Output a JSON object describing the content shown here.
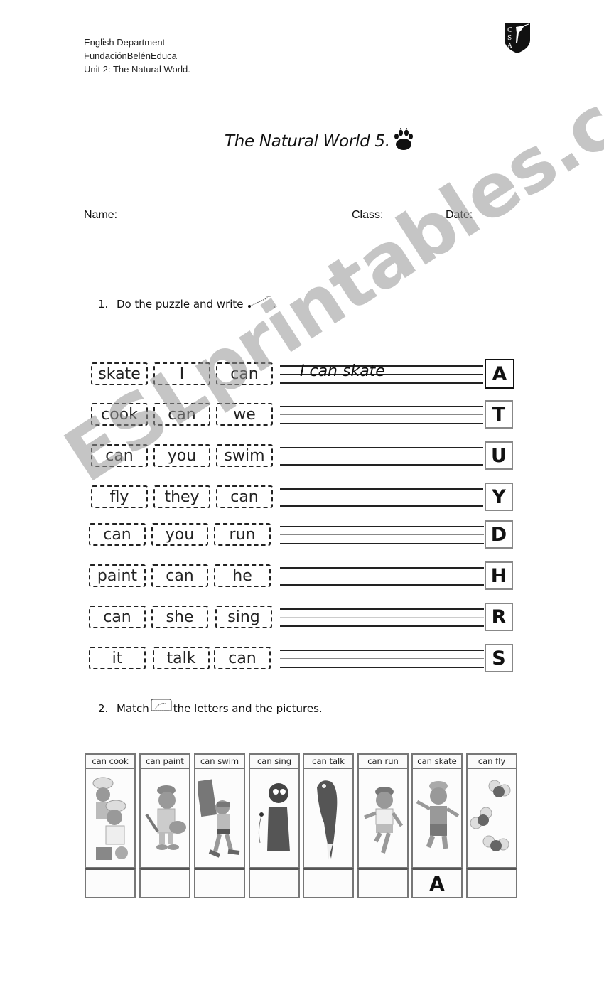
{
  "header": {
    "department": "English Department",
    "foundation": "FundaciónBelénEduca",
    "unit": "Unit 2: The Natural World."
  },
  "logo": {
    "icon": "school-crest-icon",
    "letters": "CSA"
  },
  "title": "The Natural World 5.",
  "title_icon": "paw-print-icon",
  "fields": {
    "name_label": "Name:",
    "class_label": "Class:",
    "date_label": "Date:"
  },
  "exercise1": {
    "number": "1.",
    "instruction": "Do the puzzle and write",
    "instruction_end": ".",
    "icon": "pencil-icon",
    "rows": [
      {
        "words": [
          "skate",
          "I",
          "can"
        ],
        "answer": "I can skate",
        "letter": "A"
      },
      {
        "words": [
          "cook",
          "can",
          "we"
        ],
        "answer": "",
        "letter": "T"
      },
      {
        "words": [
          "can",
          "you",
          "swim"
        ],
        "answer": "",
        "letter": "U"
      },
      {
        "words": [
          "fly",
          "they",
          "can"
        ],
        "answer": "",
        "letter": "Y"
      },
      {
        "words": [
          "can",
          "you",
          "run"
        ],
        "answer": "",
        "letter": "D"
      },
      {
        "words": [
          "paint",
          "can",
          "he"
        ],
        "answer": "",
        "letter": "H"
      },
      {
        "words": [
          "can",
          "she",
          "sing"
        ],
        "answer": "",
        "letter": "R"
      },
      {
        "words": [
          "it",
          "talk",
          "can"
        ],
        "answer": "",
        "letter": "S"
      }
    ]
  },
  "exercise2": {
    "number": "2.",
    "instruction_start": "Match",
    "instruction_end": "the letters and the pictures.",
    "icon": "drawing-icon",
    "columns": [
      {
        "label": "can cook",
        "picture": "chefs-cooking-picture",
        "answer": ""
      },
      {
        "label": "can paint",
        "picture": "painter-boy-picture",
        "answer": ""
      },
      {
        "label": "can swim",
        "picture": "swimmer-picture",
        "answer": ""
      },
      {
        "label": "can sing",
        "picture": "singer-picture",
        "answer": ""
      },
      {
        "label": "can talk",
        "picture": "parrot-picture",
        "answer": ""
      },
      {
        "label": "can run",
        "picture": "runner-boy-picture",
        "answer": ""
      },
      {
        "label": "can skate",
        "picture": "skater-boy-picture",
        "answer": "A"
      },
      {
        "label": "can fly",
        "picture": "birds-flying-picture",
        "answer": ""
      }
    ]
  },
  "watermark": "ESLprintables.com"
}
